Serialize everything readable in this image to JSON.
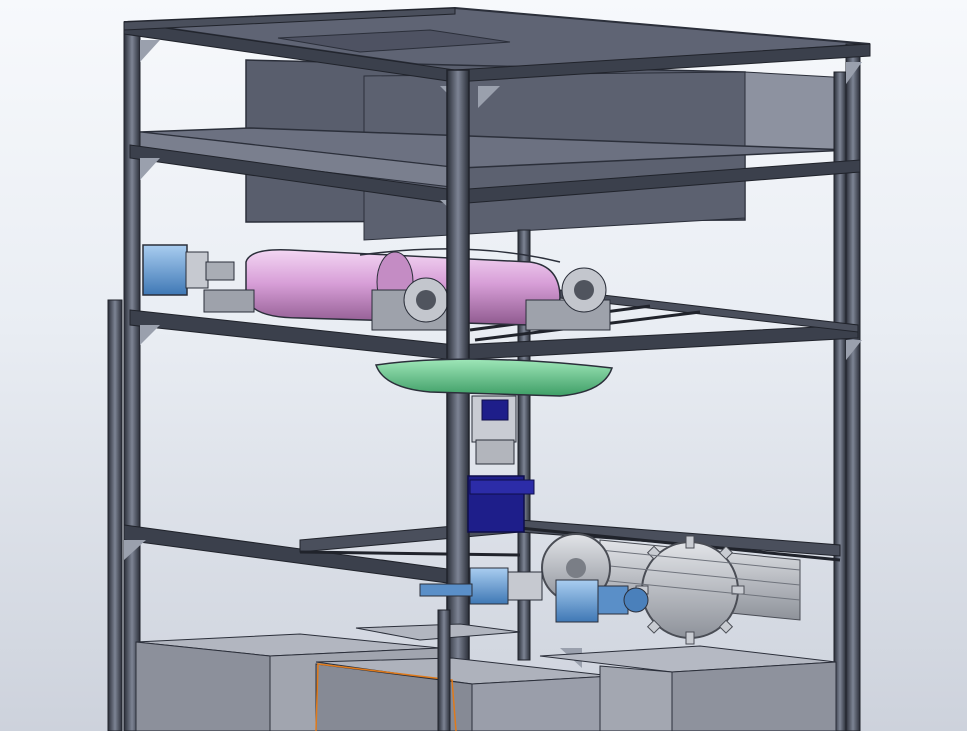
{
  "scene": {
    "background_colors": [
      "#ffffff",
      "#c9ced8"
    ],
    "frame_color": "#2b2f3a",
    "frame_highlight": "#6e7585",
    "panel_color": "#5d6271",
    "panel_light": "#858a99",
    "roller_color": "#d9a6d9",
    "plate_color": "#69c98f",
    "motor_color": "#6fa5d6",
    "servo_color": "#1e1e8a",
    "gear_color": "#b9bcc2",
    "bin_color": "#8c909b",
    "selection_color": "#e07a1a",
    "components": [
      "aluminum-frame",
      "top-hopper",
      "roller-assembly",
      "rotary-plate",
      "servo-stack",
      "gear-drive",
      "collection-bins"
    ]
  }
}
